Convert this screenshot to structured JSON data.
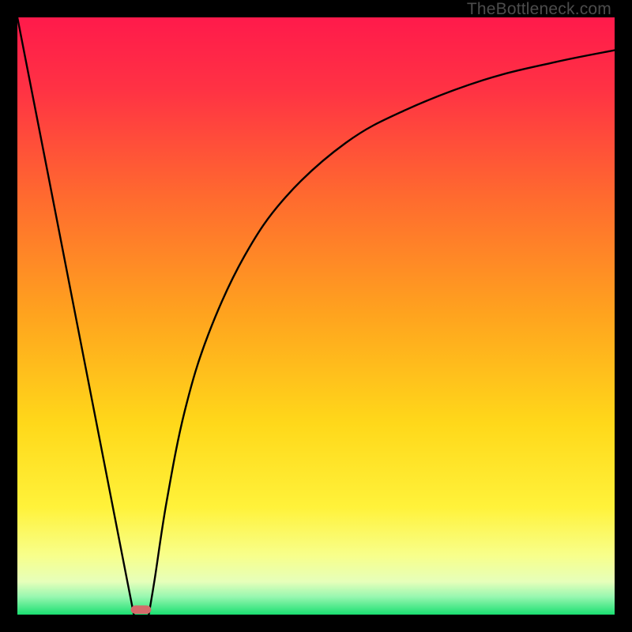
{
  "watermark": "TheBottleneck.com",
  "chart_data": {
    "type": "line",
    "title": "",
    "xlabel": "",
    "ylabel": "",
    "xlim": [
      0,
      100
    ],
    "ylim": [
      0,
      100
    ],
    "background_gradient": {
      "stops": [
        {
          "offset": 0.0,
          "color": "#ff1a4b"
        },
        {
          "offset": 0.12,
          "color": "#ff3244"
        },
        {
          "offset": 0.3,
          "color": "#ff6a2f"
        },
        {
          "offset": 0.5,
          "color": "#ffa41e"
        },
        {
          "offset": 0.68,
          "color": "#ffd81a"
        },
        {
          "offset": 0.82,
          "color": "#fff23a"
        },
        {
          "offset": 0.9,
          "color": "#f8ff8a"
        },
        {
          "offset": 0.945,
          "color": "#e6ffba"
        },
        {
          "offset": 0.97,
          "color": "#98f7b0"
        },
        {
          "offset": 1.0,
          "color": "#1adf71"
        }
      ]
    },
    "series": [
      {
        "name": "left-branch",
        "x": [
          0,
          5,
          10,
          14,
          17,
          18.5,
          19.5
        ],
        "y": [
          100,
          74.4,
          48.7,
          28.2,
          12.8,
          5.1,
          0
        ]
      },
      {
        "name": "right-branch",
        "x": [
          22,
          23,
          25,
          28,
          32,
          38,
          45,
          55,
          65,
          78,
          90,
          100
        ],
        "y": [
          0,
          6,
          19,
          34,
          47,
          60,
          70,
          79,
          84.5,
          89.5,
          92.5,
          94.5
        ]
      }
    ],
    "marker": {
      "name": "bottleneck-marker",
      "x_center": 20.7,
      "width": 3.4,
      "height": 1.4,
      "color": "#d46a6a"
    }
  }
}
